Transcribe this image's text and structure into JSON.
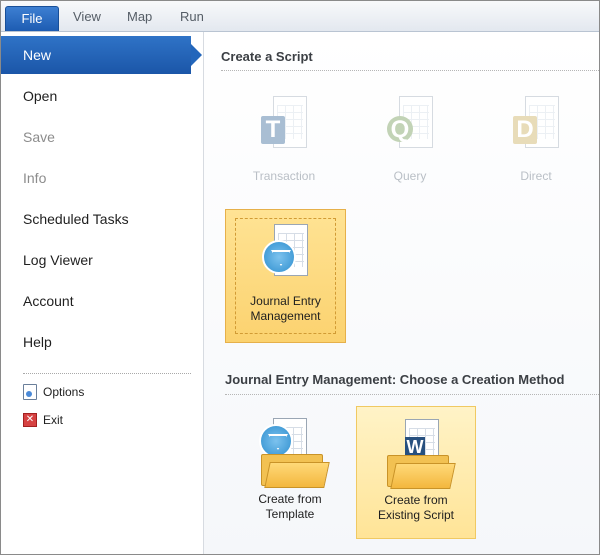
{
  "tabs": {
    "file": "File",
    "view": "View",
    "map": "Map",
    "run": "Run"
  },
  "nav": {
    "selected": "New",
    "items": [
      "Open",
      "Save",
      "Info",
      "Scheduled Tasks",
      "Log Viewer",
      "Account",
      "Help"
    ],
    "disabled": [
      "Save",
      "Info"
    ],
    "options_label": "Options",
    "exit_label": "Exit"
  },
  "create_script": {
    "title": "Create a Script",
    "tiles": [
      {
        "label": "Transaction",
        "badge": "T",
        "state": "disabled"
      },
      {
        "label": "Query",
        "badge": "Q",
        "state": "disabled"
      },
      {
        "label": "Direct",
        "badge": "D",
        "state": "disabled"
      }
    ],
    "jem_tile_line1": "Journal Entry",
    "jem_tile_line2": "Management"
  },
  "creation_method": {
    "title": "Journal Entry Management: Choose a Creation Method",
    "template_line1": "Create from",
    "template_line2": "Template",
    "existing_line1": "Create from",
    "existing_line2": "Existing Script",
    "existing_badge": "W"
  },
  "colors": {
    "accent": "#2366bb",
    "selected_tile": "#fbd26f",
    "disabled_text": "#b9bfc6"
  }
}
